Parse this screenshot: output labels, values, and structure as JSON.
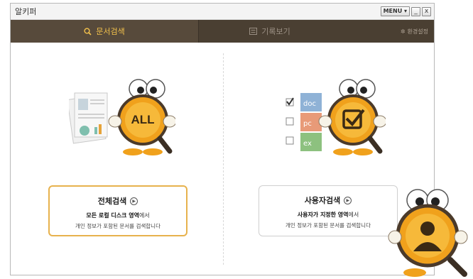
{
  "app": {
    "title": "알키퍼"
  },
  "titlebar": {
    "menu_label": "MENU ▾",
    "minimize": "_",
    "close": "x"
  },
  "tabs": {
    "search": "문서검색",
    "history": "기록보기",
    "settings": "환경설정"
  },
  "all_search": {
    "mascot_label": "ALL",
    "title": "전체검색",
    "line1_bold": "모든 로컬 디스크 영역",
    "line1_rest": "에서",
    "line2": "개인 정보가 포함된 문서를 검색합니다"
  },
  "user_search": {
    "title": "사용자검색",
    "line1_bold": "사용자가 지정한 영역",
    "line1_rest": "에서",
    "line2": "개인 정보가 포함된 문서를 검색합니다",
    "file_labels": [
      "doc",
      "pc",
      "ex"
    ]
  },
  "colors": {
    "accent": "#f3c24c",
    "tabbar": "#4a3f32",
    "mascot": "#f0a11c"
  }
}
